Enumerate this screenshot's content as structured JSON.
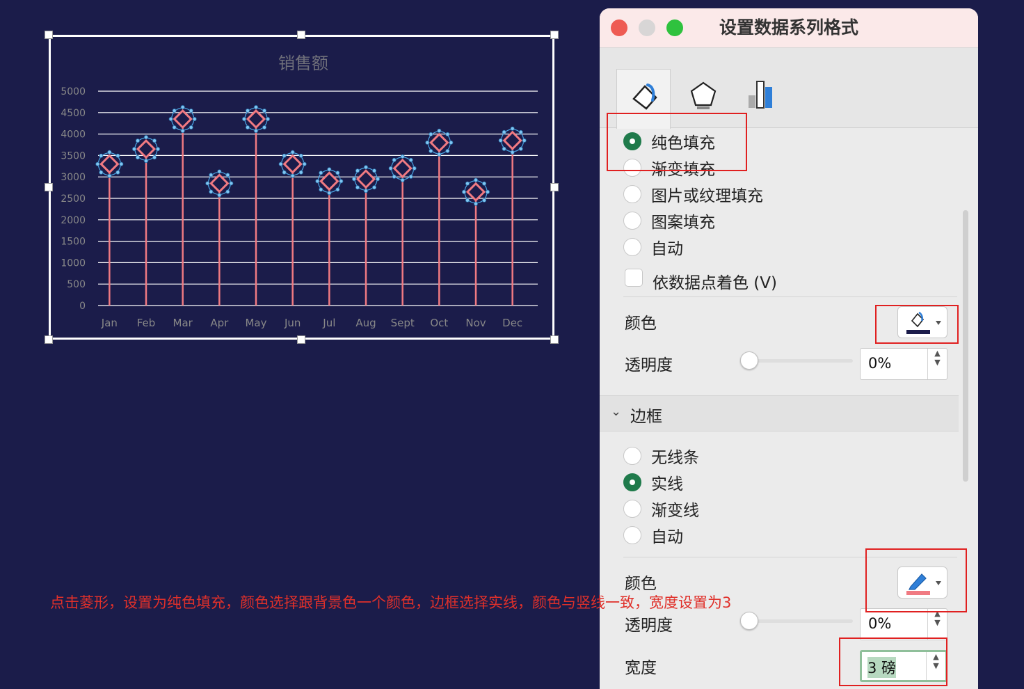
{
  "chart_data": {
    "type": "line",
    "title": "销售额",
    "categories": [
      "Jan",
      "Feb",
      "Mar",
      "Apr",
      "May",
      "Jun",
      "Jul",
      "Aug",
      "Sept",
      "Oct",
      "Nov",
      "Dec"
    ],
    "values": [
      3300,
      3650,
      4350,
      2850,
      4350,
      3300,
      2900,
      2950,
      3200,
      3800,
      2650,
      3850
    ],
    "y_ticks": [
      "5000",
      "4500",
      "4000",
      "3500",
      "3000",
      "2500",
      "2000",
      "1500",
      "1000",
      "500",
      "0"
    ],
    "ylim": [
      0,
      5000
    ],
    "grid": true,
    "colors": {
      "line": "#f07a82",
      "marker": "#f07a82",
      "marker_fill": "#1b1c4a",
      "grid": "#ffffff",
      "text": "#888888"
    }
  },
  "panel": {
    "title": "设置数据系列格式",
    "fill_options": [
      "纯色填充",
      "渐变填充",
      "图片或纹理填充",
      "图案填充",
      "自动"
    ],
    "vary_color_label": "依数据点着色 (V)",
    "color_label": "颜色",
    "transparency_label": "透明度",
    "transparency_value": "0%",
    "border_section": "边框",
    "border_options": [
      "无线条",
      "实线",
      "渐变线",
      "自动"
    ],
    "border_color_label": "颜色",
    "border_transparency_label": "透明度",
    "border_transparency_value": "0%",
    "width_label": "宽度",
    "width_value": "3 磅",
    "fill_color": "#1b1c4a",
    "line_color": "#f07a82"
  },
  "annotation": "点击菱形，设置为纯色填充，颜色选择跟背景色一个颜色，边框选择实线，颜色与竖线一致，宽度设置为3"
}
